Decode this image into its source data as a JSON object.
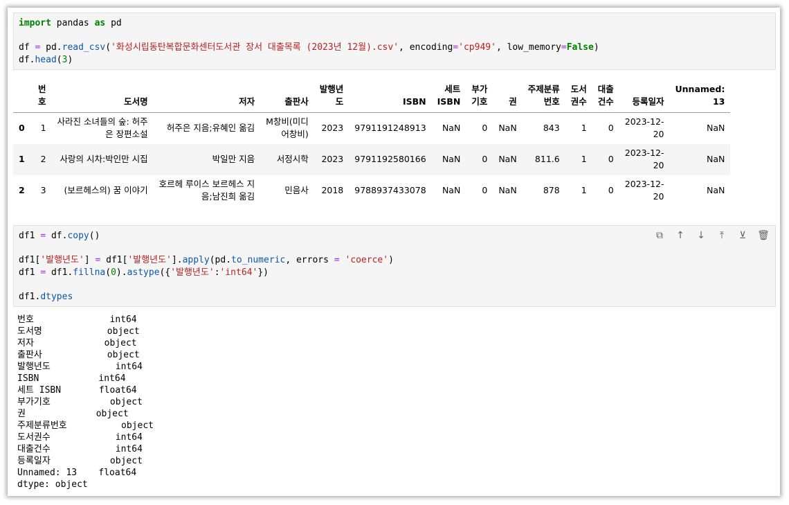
{
  "cell1": {
    "line1_kw1": "import",
    "line1_mod": " pandas ",
    "line1_kw2": "as",
    "line1_alias": " pd",
    "line3_a": "df ",
    "line3_eq": "=",
    "line3_b": " pd.",
    "line3_fn": "read_csv",
    "line3_c": "(",
    "line3_str": "'화성시립동탄복합문화센터도서관 장서 대출목록 (2023년 12월).csv'",
    "line3_d": ", encoding",
    "line3_eq2": "=",
    "line3_str2": "'cp949'",
    "line3_e": ", low_memory",
    "line3_eq3": "=",
    "line3_kw": "False",
    "line3_f": ")",
    "line4_a": "df.",
    "line4_fn": "head",
    "line4_b": "(",
    "line4_num": "3",
    "line4_c": ")"
  },
  "table": {
    "columns": [
      "번\n호",
      "도서명",
      "저자",
      "출판사",
      "발행년\n도",
      "ISBN",
      "세트\nISBN",
      "부가\n기호",
      "권",
      "주제분류\n번호",
      "도서\n권수",
      "대출\n건수",
      "등록일자",
      "Unnamed:\n13"
    ],
    "rows": [
      {
        "index": "0",
        "cells": [
          "1",
          "사라진 소녀들의 숲: 허주\n은 장편소설",
          "허주은 지음;유혜인 옮김",
          "M창비(미디\n어창비)",
          "2023",
          "9791191248913",
          "NaN",
          "0",
          "NaN",
          "843",
          "1",
          "0",
          "2023-12-\n20",
          "NaN"
        ]
      },
      {
        "index": "1",
        "cells": [
          "2",
          "사랑의 시차:박인만 시집",
          "박일만 지음",
          "서정시학",
          "2023",
          "9791192580166",
          "NaN",
          "0",
          "NaN",
          "811.6",
          "1",
          "0",
          "2023-12-\n20",
          "NaN"
        ]
      },
      {
        "index": "2",
        "cells": [
          "3",
          "(보르헤스의) 꿈 이야기",
          "호르헤 루이스 보르헤스 지\n음;남진희 옮김",
          "민음사",
          "2018",
          "9788937433078",
          "NaN",
          "0",
          "NaN",
          "878",
          "1",
          "0",
          "2023-12-\n20",
          "NaN"
        ]
      }
    ]
  },
  "cell2": {
    "l1_a": "df1 ",
    "l1_eq": "=",
    "l1_b": " df.",
    "l1_fn": "copy",
    "l1_c": "()",
    "l3_a": "df1[",
    "l3_s1": "'발행년도'",
    "l3_b": "] ",
    "l3_eq": "=",
    "l3_c": " df1[",
    "l3_s2": "'발행년도'",
    "l3_d": "].",
    "l3_fn": "apply",
    "l3_e": "(pd.",
    "l3_fn2": "to_numeric",
    "l3_f": ", errors ",
    "l3_eq2": "=",
    "l3_g": " ",
    "l3_s3": "'coerce'",
    "l3_h": ")",
    "l4_a": "df1 ",
    "l4_eq": "=",
    "l4_b": " df1.",
    "l4_fn": "fillna",
    "l4_c": "(",
    "l4_num": "0",
    "l4_d": ").",
    "l4_fn2": "astype",
    "l4_e": "({",
    "l4_s1": "'발행년도'",
    "l4_f": ":",
    "l4_s2": "'int64'",
    "l4_g": "})",
    "l6_a": "df1.",
    "l6_fn": "dtypes"
  },
  "toolbar": {
    "copy": "⧉",
    "up": "↑",
    "down": "↓",
    "export": "⤒",
    "insert": "⊻",
    "delete": "🗑"
  },
  "output": "번호              int64\n도서명            object\n저자             object\n출판사            object\n발행년도            int64\nISBN           int64\n세트 ISBN       float64\n부가기호           object\n권             object\n주제분류번호          object\n도서권수            int64\n대출건수            int64\n등록일자           object\nUnnamed: 13    float64\ndtype: object"
}
